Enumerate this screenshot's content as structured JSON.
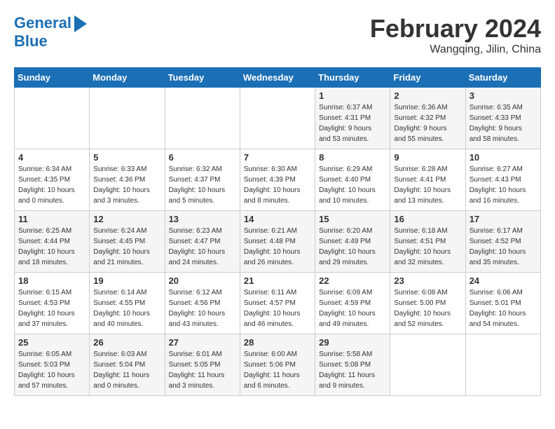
{
  "logo": {
    "line1": "General",
    "line2": "Blue"
  },
  "title": "February 2024",
  "location": "Wangqing, Jilin, China",
  "days_of_week": [
    "Sunday",
    "Monday",
    "Tuesday",
    "Wednesday",
    "Thursday",
    "Friday",
    "Saturday"
  ],
  "weeks": [
    [
      {
        "day": "",
        "info": ""
      },
      {
        "day": "",
        "info": ""
      },
      {
        "day": "",
        "info": ""
      },
      {
        "day": "",
        "info": ""
      },
      {
        "day": "1",
        "info": "Sunrise: 6:37 AM\nSunset: 4:31 PM\nDaylight: 9 hours\nand 53 minutes."
      },
      {
        "day": "2",
        "info": "Sunrise: 6:36 AM\nSunset: 4:32 PM\nDaylight: 9 hours\nand 55 minutes."
      },
      {
        "day": "3",
        "info": "Sunrise: 6:35 AM\nSunset: 4:33 PM\nDaylight: 9 hours\nand 58 minutes."
      }
    ],
    [
      {
        "day": "4",
        "info": "Sunrise: 6:34 AM\nSunset: 4:35 PM\nDaylight: 10 hours\nand 0 minutes."
      },
      {
        "day": "5",
        "info": "Sunrise: 6:33 AM\nSunset: 4:36 PM\nDaylight: 10 hours\nand 3 minutes."
      },
      {
        "day": "6",
        "info": "Sunrise: 6:32 AM\nSunset: 4:37 PM\nDaylight: 10 hours\nand 5 minutes."
      },
      {
        "day": "7",
        "info": "Sunrise: 6:30 AM\nSunset: 4:39 PM\nDaylight: 10 hours\nand 8 minutes."
      },
      {
        "day": "8",
        "info": "Sunrise: 6:29 AM\nSunset: 4:40 PM\nDaylight: 10 hours\nand 10 minutes."
      },
      {
        "day": "9",
        "info": "Sunrise: 6:28 AM\nSunset: 4:41 PM\nDaylight: 10 hours\nand 13 minutes."
      },
      {
        "day": "10",
        "info": "Sunrise: 6:27 AM\nSunset: 4:43 PM\nDaylight: 10 hours\nand 16 minutes."
      }
    ],
    [
      {
        "day": "11",
        "info": "Sunrise: 6:25 AM\nSunset: 4:44 PM\nDaylight: 10 hours\nand 18 minutes."
      },
      {
        "day": "12",
        "info": "Sunrise: 6:24 AM\nSunset: 4:45 PM\nDaylight: 10 hours\nand 21 minutes."
      },
      {
        "day": "13",
        "info": "Sunrise: 6:23 AM\nSunset: 4:47 PM\nDaylight: 10 hours\nand 24 minutes."
      },
      {
        "day": "14",
        "info": "Sunrise: 6:21 AM\nSunset: 4:48 PM\nDaylight: 10 hours\nand 26 minutes."
      },
      {
        "day": "15",
        "info": "Sunrise: 6:20 AM\nSunset: 4:49 PM\nDaylight: 10 hours\nand 29 minutes."
      },
      {
        "day": "16",
        "info": "Sunrise: 6:18 AM\nSunset: 4:51 PM\nDaylight: 10 hours\nand 32 minutes."
      },
      {
        "day": "17",
        "info": "Sunrise: 6:17 AM\nSunset: 4:52 PM\nDaylight: 10 hours\nand 35 minutes."
      }
    ],
    [
      {
        "day": "18",
        "info": "Sunrise: 6:15 AM\nSunset: 4:53 PM\nDaylight: 10 hours\nand 37 minutes."
      },
      {
        "day": "19",
        "info": "Sunrise: 6:14 AM\nSunset: 4:55 PM\nDaylight: 10 hours\nand 40 minutes."
      },
      {
        "day": "20",
        "info": "Sunrise: 6:12 AM\nSunset: 4:56 PM\nDaylight: 10 hours\nand 43 minutes."
      },
      {
        "day": "21",
        "info": "Sunrise: 6:11 AM\nSunset: 4:57 PM\nDaylight: 10 hours\nand 46 minutes."
      },
      {
        "day": "22",
        "info": "Sunrise: 6:09 AM\nSunset: 4:59 PM\nDaylight: 10 hours\nand 49 minutes."
      },
      {
        "day": "23",
        "info": "Sunrise: 6:08 AM\nSunset: 5:00 PM\nDaylight: 10 hours\nand 52 minutes."
      },
      {
        "day": "24",
        "info": "Sunrise: 6:06 AM\nSunset: 5:01 PM\nDaylight: 10 hours\nand 54 minutes."
      }
    ],
    [
      {
        "day": "25",
        "info": "Sunrise: 6:05 AM\nSunset: 5:03 PM\nDaylight: 10 hours\nand 57 minutes."
      },
      {
        "day": "26",
        "info": "Sunrise: 6:03 AM\nSunset: 5:04 PM\nDaylight: 11 hours\nand 0 minutes."
      },
      {
        "day": "27",
        "info": "Sunrise: 6:01 AM\nSunset: 5:05 PM\nDaylight: 11 hours\nand 3 minutes."
      },
      {
        "day": "28",
        "info": "Sunrise: 6:00 AM\nSunset: 5:06 PM\nDaylight: 11 hours\nand 6 minutes."
      },
      {
        "day": "29",
        "info": "Sunrise: 5:58 AM\nSunset: 5:08 PM\nDaylight: 11 hours\nand 9 minutes."
      },
      {
        "day": "",
        "info": ""
      },
      {
        "day": "",
        "info": ""
      }
    ]
  ]
}
